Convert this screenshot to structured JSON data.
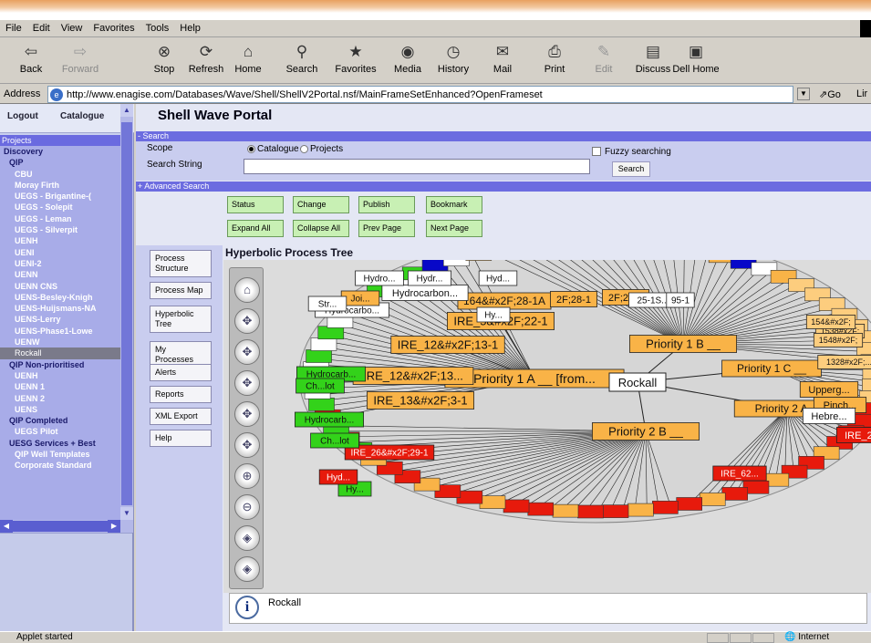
{
  "browser": {
    "menu": [
      "File",
      "Edit",
      "View",
      "Favorites",
      "Tools",
      "Help"
    ],
    "toolbar": [
      {
        "label": "Back",
        "icon": "back-arrow-icon",
        "enabled": true
      },
      {
        "label": "Forward",
        "icon": "forward-arrow-icon",
        "enabled": false
      },
      {
        "label": "Stop",
        "icon": "stop-icon",
        "enabled": true
      },
      {
        "label": "Refresh",
        "icon": "refresh-icon",
        "enabled": true
      },
      {
        "label": "Home",
        "icon": "home-icon",
        "enabled": true
      },
      {
        "label": "Search",
        "icon": "search-icon",
        "enabled": true
      },
      {
        "label": "Favorites",
        "icon": "favorites-icon",
        "enabled": true
      },
      {
        "label": "Media",
        "icon": "media-icon",
        "enabled": true
      },
      {
        "label": "History",
        "icon": "history-icon",
        "enabled": true
      },
      {
        "label": "Mail",
        "icon": "mail-icon",
        "enabled": true
      },
      {
        "label": "Print",
        "icon": "print-icon",
        "enabled": true
      },
      {
        "label": "Edit",
        "icon": "edit-icon",
        "enabled": false
      },
      {
        "label": "Discuss",
        "icon": "discuss-icon",
        "enabled": true
      },
      {
        "label": "Dell Home",
        "icon": "dell-home-icon",
        "enabled": true
      }
    ],
    "address_label": "Address",
    "url": "http://www.enagise.com/Databases/Wave/Shell/ShellV2Portal.nsf/MainFrameSetEnhanced?OpenFrameset",
    "go_label": "Go",
    "links_label": "Lir",
    "status_text": "Applet started",
    "zone_text": "Internet"
  },
  "sidebar": {
    "logout": "Logout",
    "catalogue": "Catalogue",
    "section": "Projects",
    "items": [
      {
        "label": "Discovery",
        "style": "c"
      },
      {
        "label": "QIP",
        "style": "c",
        "indent": 1
      },
      {
        "label": "CBU",
        "style": "w",
        "indent": 2
      },
      {
        "label": "Moray Firth",
        "style": "w",
        "indent": 2
      },
      {
        "label": "UEGS - Brigantine-(",
        "style": "w",
        "indent": 2
      },
      {
        "label": "UEGS - Solepit",
        "style": "w",
        "indent": 2
      },
      {
        "label": "UEGS - Leman",
        "style": "w",
        "indent": 2
      },
      {
        "label": "UEGS - Silverpit",
        "style": "w",
        "indent": 2
      },
      {
        "label": "UENH",
        "style": "w",
        "indent": 2
      },
      {
        "label": "UENI",
        "style": "w",
        "indent": 2
      },
      {
        "label": "UENI-2",
        "style": "w",
        "indent": 2
      },
      {
        "label": "UENN",
        "style": "w",
        "indent": 2
      },
      {
        "label": "UENN CNS",
        "style": "w",
        "indent": 2
      },
      {
        "label": "UENS-Besley-Knigh",
        "style": "w",
        "indent": 2
      },
      {
        "label": "UENS-Huijsmans-NA",
        "style": "w",
        "indent": 2
      },
      {
        "label": "UENS-Lerry",
        "style": "w",
        "indent": 2
      },
      {
        "label": "UENS-Phase1-Lowe",
        "style": "w",
        "indent": 2
      },
      {
        "label": "UENW",
        "style": "w",
        "indent": 2
      },
      {
        "label": "Rockall",
        "style": "sel",
        "indent": 2
      },
      {
        "label": "QIP Non-prioritised",
        "style": "c",
        "indent": 1
      },
      {
        "label": "UENH",
        "style": "w",
        "indent": 2
      },
      {
        "label": "UENN 1",
        "style": "w",
        "indent": 2
      },
      {
        "label": "UENN 2",
        "style": "w",
        "indent": 2
      },
      {
        "label": "UENS",
        "style": "w",
        "indent": 2
      },
      {
        "label": "QIP Completed",
        "style": "c",
        "indent": 1
      },
      {
        "label": "UEGS Pilot",
        "style": "w",
        "indent": 2
      },
      {
        "label": "UESG Services + Best",
        "style": "c",
        "indent": 1
      },
      {
        "label": "QIP Well Templates",
        "style": "w",
        "indent": 2
      },
      {
        "label": "Corporate Standard",
        "style": "w",
        "indent": 2
      }
    ]
  },
  "portal": {
    "title": "Shell Wave Portal",
    "search_bar": "- Search",
    "scope_label": "Scope",
    "scope_opt1": "Catalogue",
    "scope_opt2": "Projects",
    "scope_selected": "Catalogue",
    "search_string_label": "Search String",
    "search_value": "",
    "fuzzy_label": "Fuzzy searching",
    "fuzzy_checked": false,
    "search_button": "Search",
    "advanced_bar": "+ Advanced Search",
    "actions": [
      "Status",
      "Change",
      "Publish",
      "Bookmark",
      "Expand All",
      "Collapse All",
      "Prev Page",
      "Next Page"
    ],
    "nav": [
      "Process Structure",
      "Process Map",
      "Hyperbolic Tree",
      "My Processes",
      "Alerts",
      "Reports",
      "XML Export",
      "Help"
    ],
    "tree_title": "Hyperbolic Process Tree",
    "info_text": "Rockall"
  },
  "tree": {
    "root": "Rockall",
    "colors": {
      "orange": "#f9b347",
      "lightorange": "#fdcd7e",
      "green": "#33d21a",
      "red": "#e71a0c",
      "blue": "#0808c8",
      "white": "#ffffff",
      "line": "#222222"
    },
    "nodes": [
      {
        "label": "Priority 1 A __ [from...",
        "c": "orange",
        "fs": 14
      },
      {
        "label": "Priority 1 B __",
        "c": "orange",
        "fs": 13
      },
      {
        "label": "Priority 1 C __",
        "c": "orange",
        "fs": 12
      },
      {
        "label": "Priority 2 A ...",
        "c": "orange",
        "fs": 12
      },
      {
        "label": "Priority 2 B __",
        "c": "orange",
        "fs": 13
      },
      {
        "label": "IRE_5&#x2F;22-1",
        "c": "orange",
        "fs": 13
      },
      {
        "label": "IRE_12&#x2F;13-1",
        "c": "orange",
        "fs": 13
      },
      {
        "label": "IRE_12&#x2F;13...",
        "c": "orange",
        "fs": 13
      },
      {
        "label": "IRE_13&#x2F;3-1",
        "c": "orange",
        "fs": 13
      },
      {
        "label": "164&#x2F;28-1A",
        "c": "orange",
        "fs": 12
      },
      {
        "label": "2F;28-1",
        "c": "orange",
        "fs": 11
      },
      {
        "label": "2F;25-2",
        "c": "orange",
        "fs": 11
      },
      {
        "label": "25-1S...",
        "c": "white",
        "fs": 10
      },
      {
        "label": "95-1",
        "c": "white",
        "fs": 10
      },
      {
        "label": "Upperg...",
        "c": "orange",
        "fs": 11
      },
      {
        "label": "Pinch...",
        "c": "orange",
        "fs": 11
      },
      {
        "label": "Hebre...",
        "c": "white",
        "fs": 11
      },
      {
        "label": "IRE_2...",
        "c": "red",
        "fs": 11
      },
      {
        "label": "IRE_62...",
        "c": "red",
        "fs": 10
      },
      {
        "label": "IRE_26&#x2F;29-1",
        "c": "red",
        "fs": 10
      },
      {
        "label": "Hydrocarbon...",
        "c": "white",
        "fs": 11
      },
      {
        "label": "Hydrocarbo...",
        "c": "white",
        "fs": 10
      },
      {
        "label": "Hydro...",
        "c": "white",
        "fs": 10
      },
      {
        "label": "Hydr...",
        "c": "white",
        "fs": 10
      },
      {
        "label": "Hyd...",
        "c": "white",
        "fs": 10
      },
      {
        "label": "Hy...",
        "c": "white",
        "fs": 10
      },
      {
        "label": "Hydrocarb...",
        "c": "green",
        "fs": 10
      },
      {
        "label": "Hydrocarb...",
        "c": "green",
        "fs": 10
      },
      {
        "label": "Hy...",
        "c": "green",
        "fs": 10
      },
      {
        "label": "Hyd...",
        "c": "red",
        "fs": 10
      },
      {
        "label": "Joi...",
        "c": "orange",
        "fs": 10
      },
      {
        "label": "Str...",
        "c": "white",
        "fs": 10
      },
      {
        "label": "Ch...lot",
        "c": "green",
        "fs": 10
      },
      {
        "label": "Ch...lot",
        "c": "green",
        "fs": 10
      },
      {
        "label": "1328#x2F;...",
        "c": "lightorange",
        "fs": 9
      },
      {
        "label": "1538#x2F;",
        "c": "lightorange",
        "fs": 9
      },
      {
        "label": "1548#x2F;",
        "c": "lightorange",
        "fs": 9
      },
      {
        "label": "154&#x2F;",
        "c": "lightorange",
        "fs": 9
      }
    ]
  }
}
